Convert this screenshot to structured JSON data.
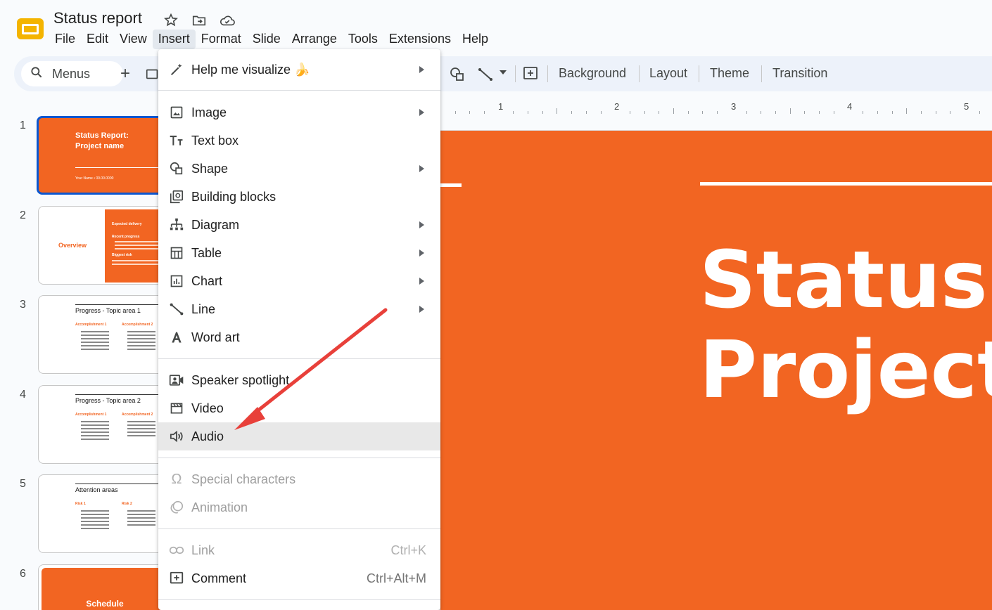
{
  "app": {
    "title": "Status report",
    "logo_icon": "slides-logo-icon",
    "brand_color": "#f4b400"
  },
  "menubar": [
    "File",
    "Edit",
    "View",
    "Insert",
    "Format",
    "Slide",
    "Arrange",
    "Tools",
    "Extensions",
    "Help"
  ],
  "active_menu": "Insert",
  "toolbar": {
    "search_label": "Menus",
    "background": "Background",
    "layout": "Layout",
    "theme": "Theme",
    "transition": "Transition"
  },
  "insert_menu": {
    "help_visualize": "Help me visualize",
    "help_visualize_emoji": "🍌",
    "image": "Image",
    "text_box": "Text box",
    "shape": "Shape",
    "building_blocks": "Building blocks",
    "diagram": "Diagram",
    "table": "Table",
    "chart": "Chart",
    "line": "Line",
    "word_art": "Word art",
    "speaker_spotlight": "Speaker spotlight",
    "video": "Video",
    "audio": "Audio",
    "special_characters": "Special characters",
    "animation": "Animation",
    "link": "Link",
    "link_shortcut": "Ctrl+K",
    "comment": "Comment",
    "comment_shortcut": "Ctrl+Alt+M"
  },
  "slides": [
    {
      "num": "1",
      "title_line1": "Status Report:",
      "title_line2": "Project name",
      "byline": "Your Name • 00.00.0000"
    },
    {
      "num": "2",
      "left_label": "Overview",
      "h1": "Expected delivery",
      "h2": "Recent progress",
      "h3": "Biggest risk"
    },
    {
      "num": "3",
      "title": "Progress - Topic area 1",
      "col1": "Accomplishment 1",
      "col2": "Accomplishment 2"
    },
    {
      "num": "4",
      "title": "Progress - Topic area 2",
      "col1": "Accomplishment 1",
      "col2": "Accomplishment 2"
    },
    {
      "num": "5",
      "title": "Attention areas",
      "col1": "Risk 1",
      "col2": "Risk 2"
    },
    {
      "num": "6",
      "title": "Schedule"
    }
  ],
  "ruler": [
    "1",
    "2",
    "3",
    "4",
    "5"
  ],
  "canvas": {
    "line1": "Status R",
    "line2": "Project n",
    "accent": "#f26522"
  },
  "annotation": {
    "color": "#e8403a"
  }
}
